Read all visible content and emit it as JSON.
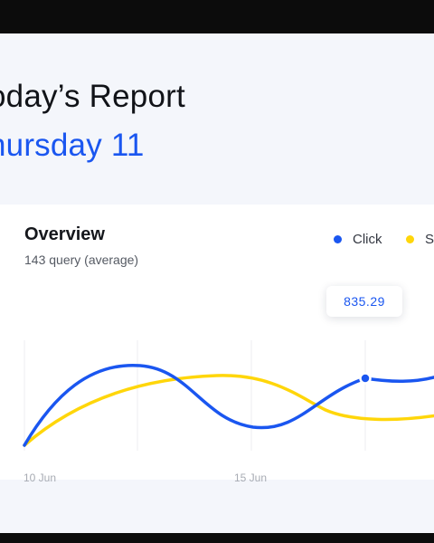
{
  "header": {
    "title": "oday’s Report",
    "date": "hursday 11"
  },
  "overview": {
    "title": "Overview",
    "subtitle": "143 query (average)",
    "legend": [
      {
        "label": "Click",
        "color": "#1a56f0"
      },
      {
        "label": "S",
        "color": "#ffd60a"
      }
    ],
    "tooltip": {
      "value": "835.29"
    }
  },
  "chart_data": {
    "type": "line",
    "x_tick_labels": [
      "10 Jun",
      "15 Jun"
    ],
    "series": [
      {
        "name": "Click",
        "color": "#1a56f0",
        "highlighted_value": "835.29"
      },
      {
        "name": "S",
        "color": "#ffd60a"
      }
    ],
    "grid": true,
    "legend_position": "top-right"
  }
}
